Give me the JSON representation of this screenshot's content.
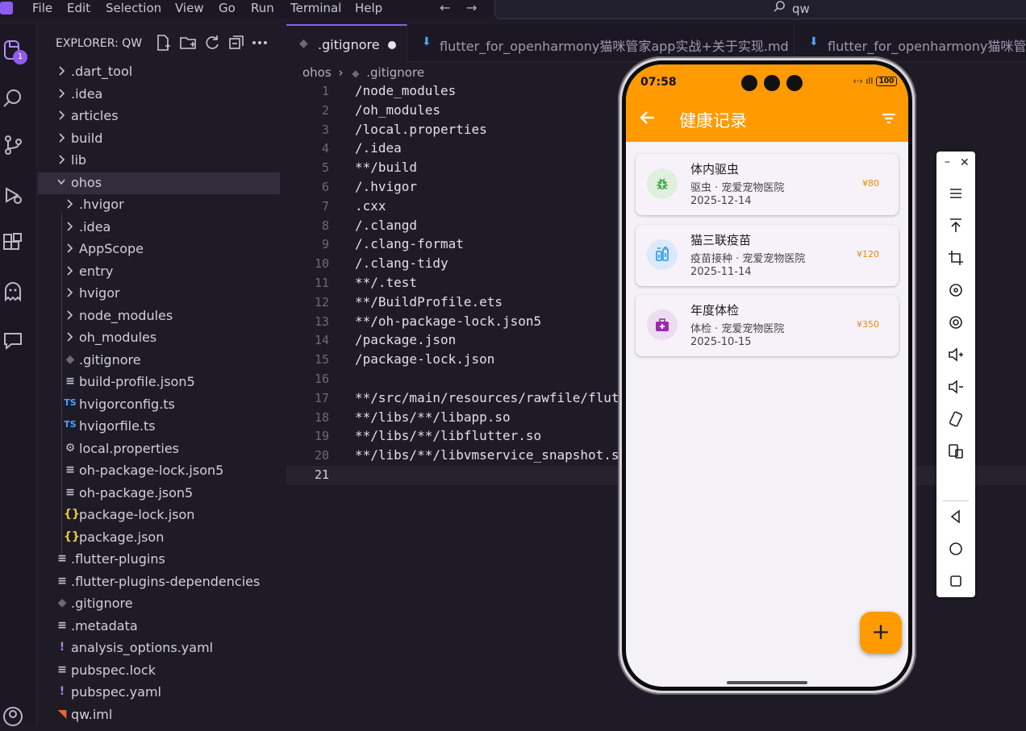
{
  "menubar": {
    "items": [
      "File",
      "Edit",
      "Selection",
      "View",
      "Go",
      "Run",
      "Terminal",
      "Help"
    ],
    "search_text": "qw"
  },
  "activity": {
    "badge": "1"
  },
  "explorer": {
    "title": "EXPLORER: QW",
    "rows": [
      {
        "label": ".dart_tool",
        "kind": "folder"
      },
      {
        "label": ".idea",
        "kind": "folder"
      },
      {
        "label": "articles",
        "kind": "folder"
      },
      {
        "label": "build",
        "kind": "folder"
      },
      {
        "label": "lib",
        "kind": "folder"
      },
      {
        "label": "ohos",
        "kind": "folder-open"
      },
      {
        "label": ".hvigor",
        "kind": "folder"
      },
      {
        "label": ".idea",
        "kind": "folder"
      },
      {
        "label": "AppScope",
        "kind": "folder"
      },
      {
        "label": "entry",
        "kind": "folder"
      },
      {
        "label": "hvigor",
        "kind": "folder"
      },
      {
        "label": "node_modules",
        "kind": "folder"
      },
      {
        "label": "oh_modules",
        "kind": "folder"
      },
      {
        "label": ".gitignore",
        "kind": "git"
      },
      {
        "label": "build-profile.json5",
        "kind": "lines"
      },
      {
        "label": "hvigorconfig.ts",
        "kind": "ts"
      },
      {
        "label": "hvigorfile.ts",
        "kind": "ts"
      },
      {
        "label": "local.properties",
        "kind": "gear"
      },
      {
        "label": "oh-package-lock.json5",
        "kind": "lines"
      },
      {
        "label": "oh-package.json5",
        "kind": "lines"
      },
      {
        "label": "package-lock.json",
        "kind": "json"
      },
      {
        "label": "package.json",
        "kind": "json"
      },
      {
        "label": ".flutter-plugins",
        "kind": "lines"
      },
      {
        "label": ".flutter-plugins-dependencies",
        "kind": "lines"
      },
      {
        "label": ".gitignore",
        "kind": "git"
      },
      {
        "label": ".metadata",
        "kind": "lines"
      },
      {
        "label": "analysis_options.yaml",
        "kind": "yaml"
      },
      {
        "label": "pubspec.lock",
        "kind": "lines"
      },
      {
        "label": "pubspec.yaml",
        "kind": "yaml"
      },
      {
        "label": "qw.iml",
        "kind": "rss"
      }
    ]
  },
  "tabs": [
    {
      "label": ".gitignore",
      "active": true,
      "modified": true
    },
    {
      "label": "flutter_for_openharmony猫咪管家app实战+关于实现.md",
      "active": false
    },
    {
      "label": "flutter_for_openharmony猫咪管家a",
      "active": false
    }
  ],
  "breadcrumb": {
    "folder": "ohos",
    "file": ".gitignore"
  },
  "code_lines": [
    "/node_modules",
    "/oh_modules",
    "/local.properties",
    "/.idea",
    "**/build",
    "/.hvigor",
    ".cxx",
    "/.clangd",
    "/.clang-format",
    "/.clang-tidy",
    "**/.test",
    "**/BuildProfile.ets",
    "**/oh-package-lock.json5",
    "/package.json",
    "/package-lock.json",
    "",
    "**/src/main/resources/rawfile/flut",
    "**/libs/**/libapp.so",
    "**/libs/**/libflutter.so",
    "**/libs/**/libvmservice_snapshot.s",
    ""
  ],
  "line_numbers": [
    "1",
    "2",
    "3",
    "4",
    "5",
    "6",
    "7",
    "8",
    "9",
    "10",
    "11",
    "12",
    "13",
    "14",
    "15",
    "16",
    "17",
    "18",
    "19",
    "20",
    "21"
  ],
  "phone": {
    "time": "07:58",
    "battery": "100",
    "title": "健康记录",
    "records": [
      {
        "title": "体内驱虫",
        "sub": "驱虫 · 宠爱宠物医院",
        "date": "2025-12-14",
        "price": "¥80",
        "icon": "bug-icon",
        "color": "#4caf50",
        "bg": "#dff0df"
      },
      {
        "title": "猫三联疫苗",
        "sub": "疫苗接种 · 宠爱宠物医院",
        "date": "2025-11-14",
        "price": "¥120",
        "icon": "vaccine-icon",
        "color": "#2196f3",
        "bg": "#dbe9f8"
      },
      {
        "title": "年度体检",
        "sub": "体检 · 宠爱宠物医院",
        "date": "2025-10-15",
        "price": "¥350",
        "icon": "medical-bag-icon",
        "color": "#9c27b0",
        "bg": "#eedcf1"
      }
    ],
    "fab": "+"
  },
  "colors": {
    "accent": "#8e5cf0",
    "appbar": "#ff9a00",
    "price": "#e38b00"
  }
}
